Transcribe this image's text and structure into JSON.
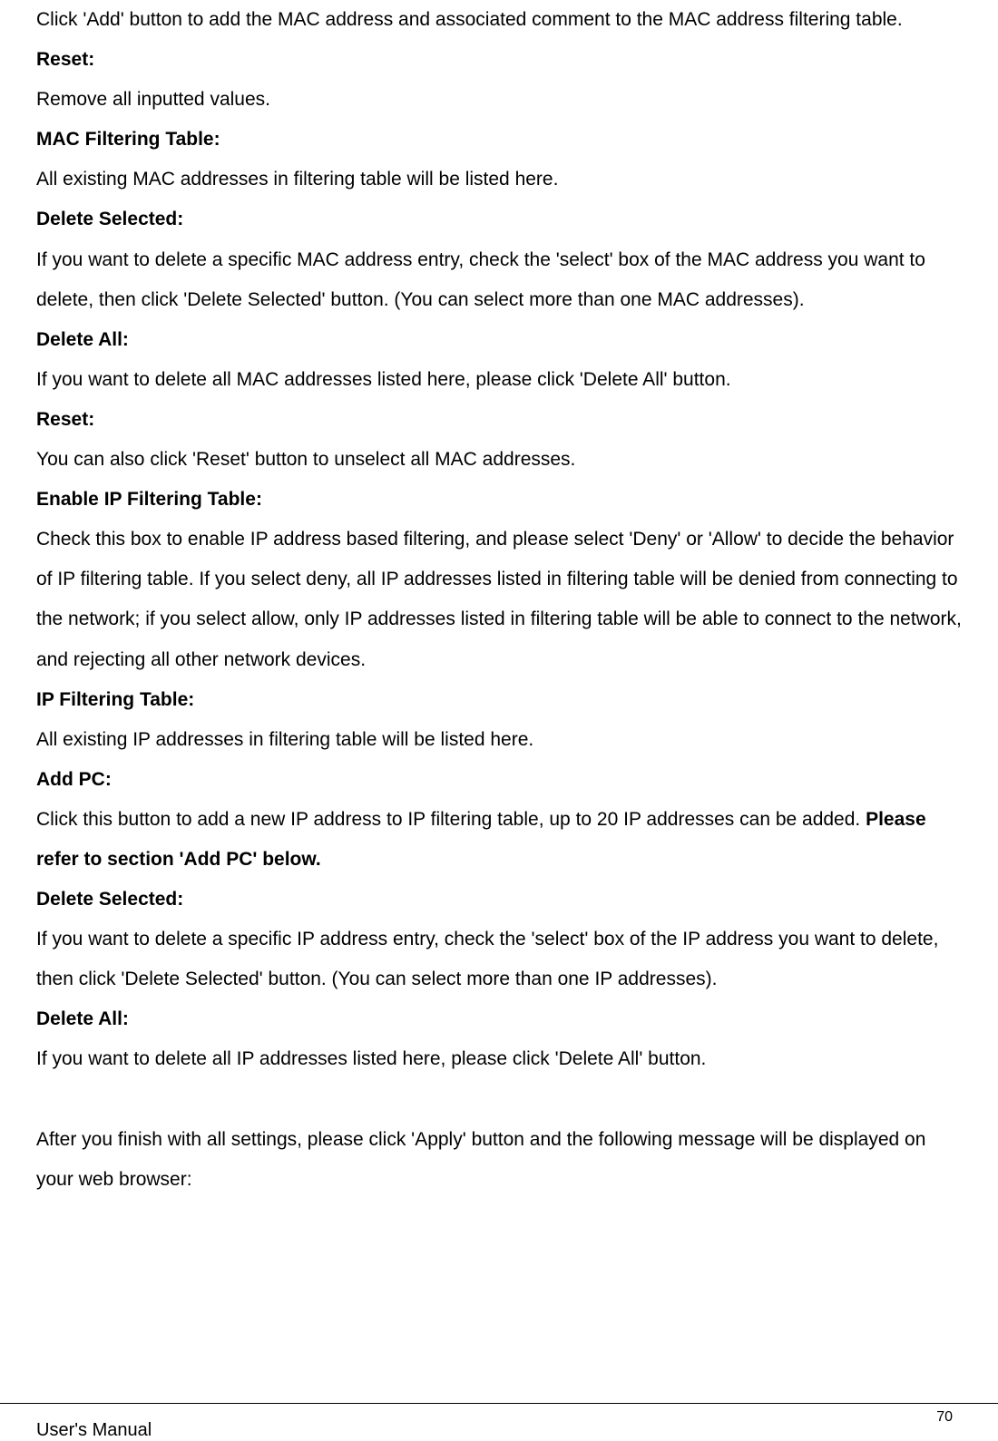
{
  "body": {
    "p1": "Click 'Add' button to add the MAC address and associated comment to the MAC address filtering table.",
    "h1": "Reset:",
    "p2": "Remove all inputted values.",
    "h2": "MAC Filtering Table:",
    "p3": "All existing MAC addresses in filtering table will be listed here.",
    "h3": "Delete Selected:",
    "p4": "If you want to delete a specific MAC address entry, check the 'select' box of the MAC address you want to delete, then click 'Delete Selected' button. (You can select more than one MAC addresses).",
    "h4": "Delete All:",
    "p5": "If you want to delete all MAC addresses listed here, please click 'Delete All' button.",
    "h5": "Reset:",
    "p6": "You can also click 'Reset' button to unselect all MAC addresses.",
    "h6": "Enable IP Filtering Table:",
    "p7": "Check this box to enable IP address based filtering, and please select 'Deny' or 'Allow' to decide the behavior of IP filtering table. If you select deny, all IP addresses listed in filtering table will be denied from connecting to the network; if you select allow, only IP addresses listed in filtering table will be able to connect to the network, and rejecting all other network devices.",
    "h7": "IP Filtering Table:",
    "p8": "All existing IP addresses in filtering table will be listed here.",
    "h8": "Add PC:",
    "p9a": "Click this button to add a new IP address to IP filtering table, up to 20 IP addresses can be added. ",
    "p9b": "Please refer to section 'Add PC' below.",
    "h9": "Delete Selected:",
    "p10": "If you want to delete a specific IP address entry, check the 'select' box of the IP address you want to delete, then click 'Delete Selected' button. (You can select more than one IP addresses).",
    "h10": "Delete All:",
    "p11": "If you want to delete all IP addresses listed here, please click 'Delete All' button.",
    "p12": "After you finish with all settings, please click 'Apply' button and the following message will be displayed on your web browser:"
  },
  "footer": {
    "left": "User's Manual",
    "right": "70"
  }
}
